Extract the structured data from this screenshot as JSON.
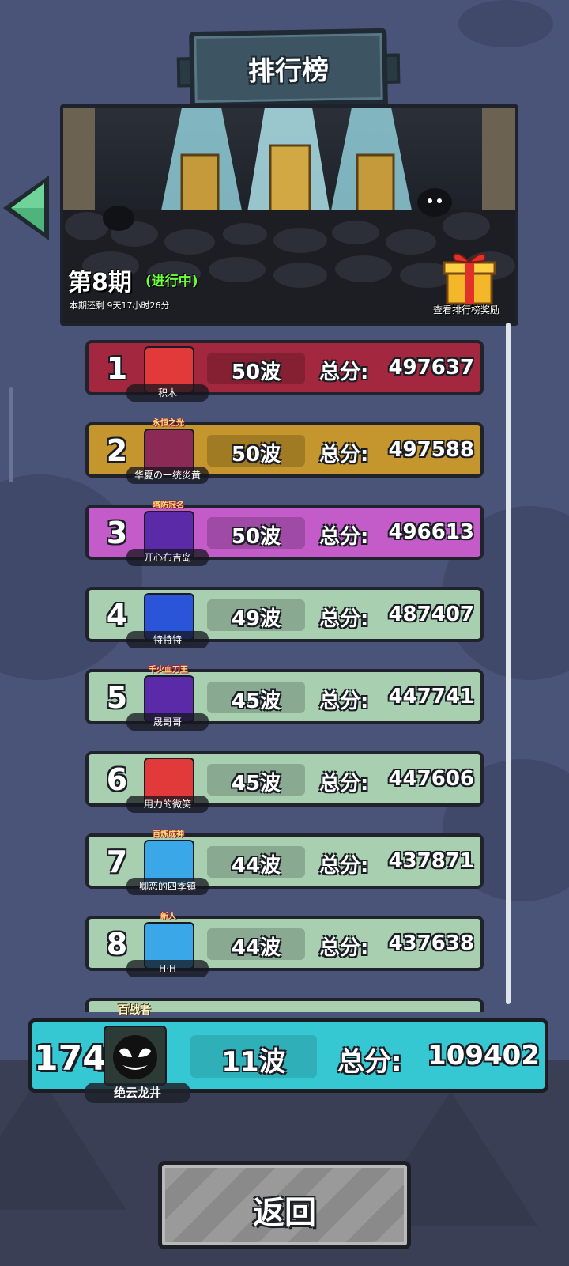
{
  "header": {
    "title": "排行榜"
  },
  "hero": {
    "period": "第8期",
    "status": "(进行中)",
    "countdown": "本期还剩 9天17小时26分",
    "reward_label": "查看排行榜奖励"
  },
  "leaderboard": {
    "score_label": "总分:",
    "rows": [
      {
        "rank": "1",
        "title": "",
        "player": "积木",
        "wave": "50波",
        "score": "497637",
        "color": "#a3283f"
      },
      {
        "rank": "2",
        "title": "永恒之光",
        "player": "华夏の一统炎黄",
        "wave": "50波",
        "score": "497588",
        "color": "#c4962d"
      },
      {
        "rank": "3",
        "title": "塔防冠名",
        "player": "开心布吉岛",
        "wave": "50波",
        "score": "496613",
        "color": "#c35bc9"
      },
      {
        "rank": "4",
        "title": "",
        "player": "特特特",
        "wave": "49波",
        "score": "487407",
        "color": "#a9cfb1"
      },
      {
        "rank": "5",
        "title": "千火血刀王",
        "player": "晟哥哥",
        "wave": "45波",
        "score": "447741",
        "color": "#a9cfb1"
      },
      {
        "rank": "6",
        "title": "",
        "player": "用力的微笑",
        "wave": "45波",
        "score": "447606",
        "color": "#a9cfb1"
      },
      {
        "rank": "7",
        "title": "百炼成神",
        "player": "卿恋的四季镇",
        "wave": "44波",
        "score": "437871",
        "color": "#a9cfb1"
      },
      {
        "rank": "8",
        "title": "新人",
        "player": "H·H",
        "wave": "44波",
        "score": "437638",
        "color": "#a9cfb1"
      }
    ]
  },
  "my_rank": {
    "rank": "174",
    "title": "百战者",
    "player": "绝云龙井",
    "wave": "11波",
    "score_label": "总分:",
    "score": "109402",
    "color": "#36c8d2"
  },
  "footer": {
    "return_label": "返回"
  },
  "icons": {
    "back": "triangle-left-icon",
    "gift": "gift-box-icon"
  }
}
